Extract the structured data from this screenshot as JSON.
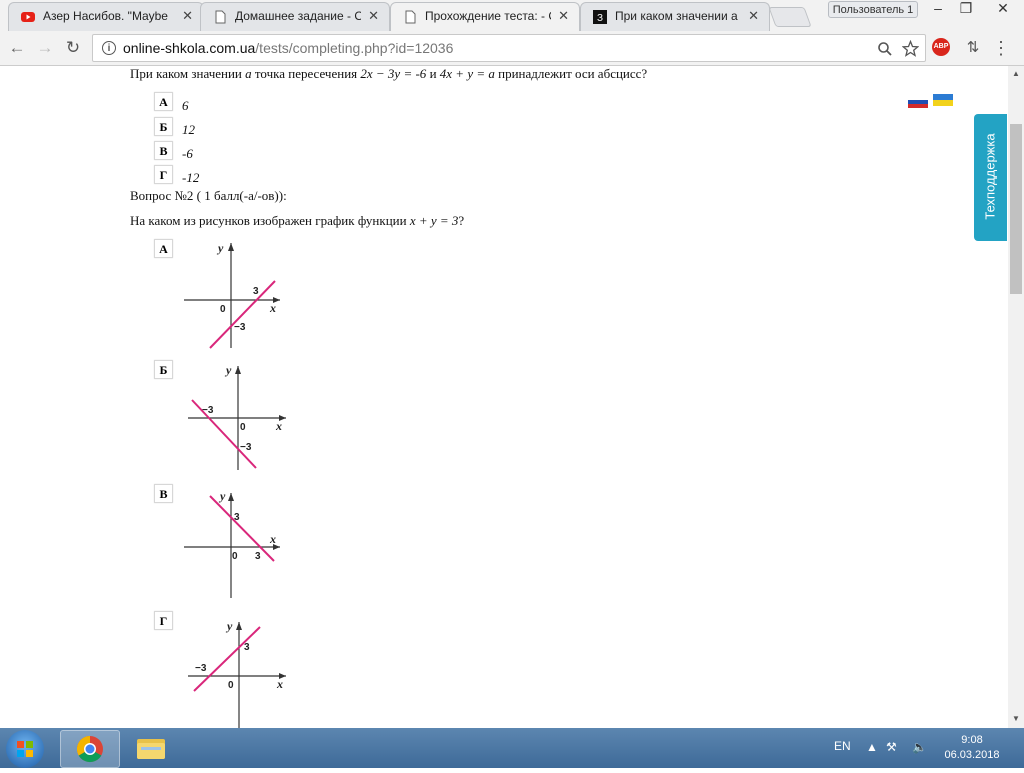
{
  "tabs": [
    {
      "label": "Азер Насибов. \"Maybe",
      "icon": "youtube-icon"
    },
    {
      "label": "Домашнее задание - О",
      "icon": "document-icon"
    },
    {
      "label": "Прохождение теста: - С",
      "icon": "document-icon"
    },
    {
      "label": "При каком значении а",
      "icon": "znanija-icon"
    }
  ],
  "window": {
    "user": "Пользователь 1"
  },
  "toolbar": {
    "url_host": "online-shkola.com.ua",
    "url_path": "/tests/completing.php?id=12036",
    "abp_label": "ABP"
  },
  "question1": {
    "text_prefix": "При каком значении ",
    "var_a": "a",
    "text_mid": " точка пересечения ",
    "eq1": "2x − 3y = -6",
    "text_and": " и ",
    "eq2": "4x + y = a",
    "text_suffix": " принадлежит оси абсцисс?",
    "options": [
      {
        "letter": "А",
        "value": "6"
      },
      {
        "letter": "Б",
        "value": "12"
      },
      {
        "letter": "В",
        "value": "-6"
      },
      {
        "letter": "Г",
        "value": "-12"
      }
    ]
  },
  "question2": {
    "header": "Вопрос №2 ( 1 балл(-а/-ов)):",
    "text_prefix": "На каком из рисунков изображен график функции ",
    "eq": "x + y = 3",
    "text_suffix": "?",
    "options": [
      {
        "letter": "А",
        "labels": {
          "x": "x",
          "y": "y",
          "origin": "0",
          "a": "3",
          "b": "−3"
        }
      },
      {
        "letter": "Б",
        "labels": {
          "x": "x",
          "y": "y",
          "origin": "0",
          "a": "−3",
          "b": "−3"
        }
      },
      {
        "letter": "В",
        "labels": {
          "x": "x",
          "y": "y",
          "origin": "0",
          "a": "3",
          "b": "3"
        }
      },
      {
        "letter": "Г",
        "labels": {
          "x": "x",
          "y": "y",
          "origin": "0",
          "a": "3",
          "b": "−3"
        }
      }
    ]
  },
  "support": {
    "label": "Техподдержка"
  },
  "taskbar": {
    "lang": "EN",
    "time": "9:08",
    "date": "06.03.2018"
  },
  "colors": {
    "line": "#d9277b",
    "support": "#23a3c4"
  }
}
